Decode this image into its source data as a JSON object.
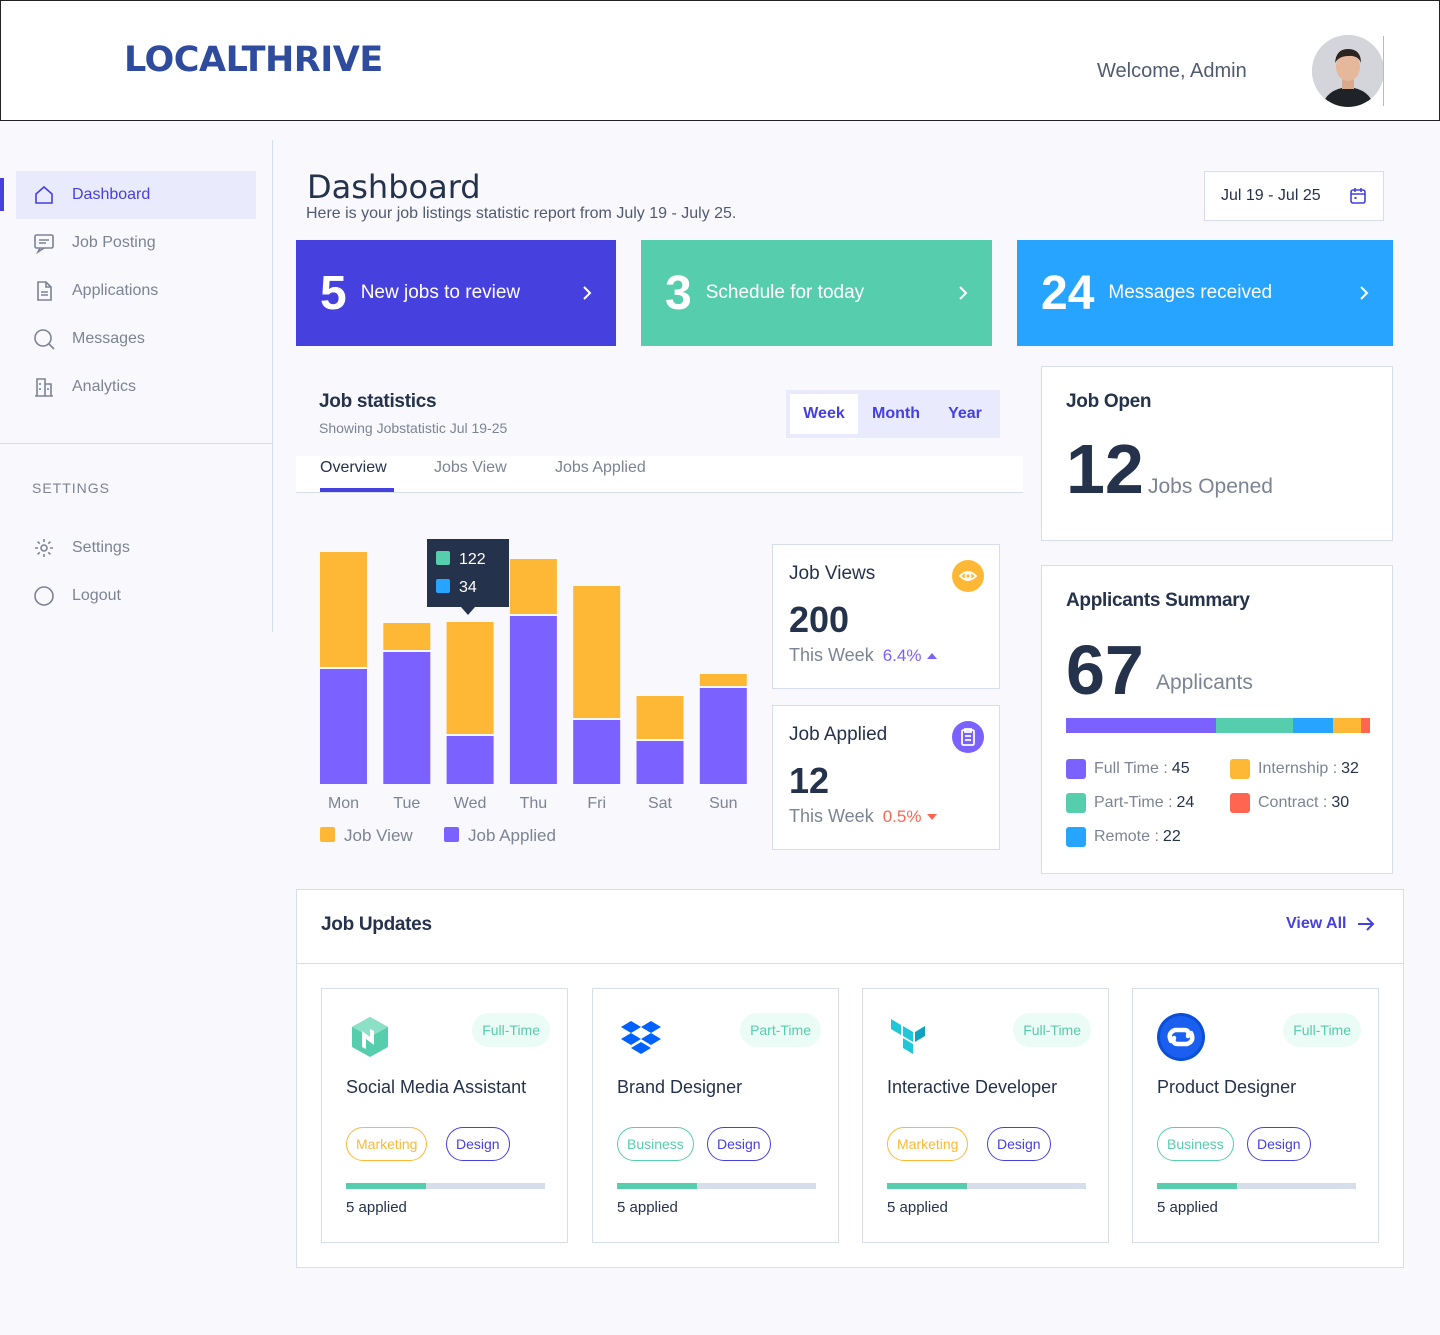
{
  "header": {
    "logo": "LOCALTHRIVE",
    "welcome": "Welcome, Admin"
  },
  "sidebar": {
    "items": [
      {
        "label": "Dashboard",
        "icon": "home-icon",
        "active": true
      },
      {
        "label": "Job Posting",
        "icon": "message-icon"
      },
      {
        "label": "Applications",
        "icon": "document-icon"
      },
      {
        "label": "Messages",
        "icon": "search-icon"
      },
      {
        "label": "Analytics",
        "icon": "building-icon"
      }
    ],
    "settings_heading": "SETTINGS",
    "settings_items": [
      {
        "label": "Settings",
        "icon": "gear-icon"
      },
      {
        "label": "Logout",
        "icon": "logout-icon"
      }
    ]
  },
  "main": {
    "title": "Dashboard",
    "subtitle": "Here is your job listings statistic report from July 19 - July 25.",
    "date_range": "Jul 19 - Jul 25"
  },
  "stats": [
    {
      "number": "5",
      "label": "New jobs to review",
      "color": "#4640de"
    },
    {
      "number": "3",
      "label": "Schedule for today",
      "color": "#56cdad"
    },
    {
      "number": "24",
      "label": "Messages received",
      "color": "#26a4ff"
    }
  ],
  "job_statistics": {
    "title": "Job statistics",
    "subtitle": "Showing Jobstatistic Jul 19-25",
    "range_tabs": [
      "Week",
      "Month",
      "Year"
    ],
    "active_range": "Week",
    "tabs": [
      "Overview",
      "Jobs View",
      "Jobs Applied"
    ],
    "active_tab": "Overview",
    "tooltip": {
      "view": "122",
      "applied": "34"
    }
  },
  "chart_data": {
    "type": "bar",
    "stacked": true,
    "categories": [
      "Mon",
      "Tue",
      "Wed",
      "Thu",
      "Fri",
      "Sat",
      "Sun"
    ],
    "series": [
      {
        "name": "Job Applied",
        "color": "#7b61ff",
        "values": [
          115,
          132,
          48,
          168,
          64,
          43,
          96
        ]
      },
      {
        "name": "Job View",
        "color": "#ffb836",
        "values": [
          115,
          27,
          112,
          55,
          132,
          43,
          12
        ]
      }
    ]
  },
  "job_views": {
    "title": "Job Views",
    "value": "200",
    "period": "This Week",
    "change": "6.4%",
    "accent": "#ffb836"
  },
  "job_applied": {
    "title": "Job Applied",
    "value": "12",
    "period": "This Week",
    "change": "0.5%",
    "accent": "#7b61ff"
  },
  "job_open": {
    "title": "Job Open",
    "value": "12",
    "label": "Jobs Opened"
  },
  "applicants_summary": {
    "title": "Applicants Summary",
    "value": "67",
    "label": "Applicants",
    "segments": [
      {
        "name": "Full Time",
        "value": "45",
        "color": "#7b61ff"
      },
      {
        "name": "Internship",
        "value": "32",
        "color": "#ffb836"
      },
      {
        "name": "Part-Time",
        "value": "24",
        "color": "#56cdad"
      },
      {
        "name": "Contract",
        "value": "30",
        "color": "#ff6550"
      },
      {
        "name": "Remote",
        "value": "22",
        "color": "#26a4ff"
      }
    ]
  },
  "job_updates": {
    "title": "Job Updates",
    "view_all": "View All",
    "jobs": [
      {
        "logo": "nomad-logo",
        "type": "Full-Time",
        "title": "Social Media Assistant",
        "tags": [
          "Marketing",
          "Design"
        ],
        "applied": "5 applied",
        "progress": 0.4
      },
      {
        "logo": "dropbox-logo",
        "type": "Part-Time",
        "title": "Brand Designer",
        "tags": [
          "Business",
          "Design"
        ],
        "applied": "5 applied",
        "progress": 0.4
      },
      {
        "logo": "terraform-logo",
        "type": "Full-Time",
        "title": "Interactive Developer",
        "tags": [
          "Marketing",
          "Design"
        ],
        "applied": "5 applied",
        "progress": 0.4
      },
      {
        "logo": "packer-logo",
        "type": "Full-Time",
        "title": "Product Designer",
        "tags": [
          "Business",
          "Design"
        ],
        "applied": "5 applied",
        "progress": 0.4
      }
    ]
  }
}
